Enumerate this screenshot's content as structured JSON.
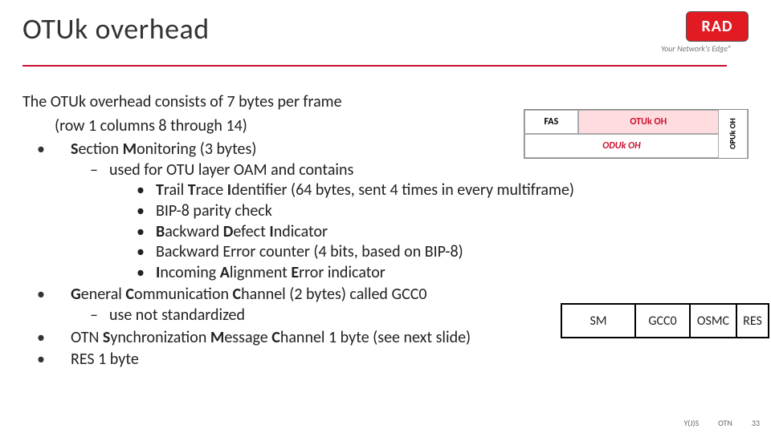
{
  "header": {
    "title": "OTUk overhead",
    "logo_text": "RAD",
    "tagline": "Your Network's Edge®"
  },
  "intro": {
    "line1": "The OTUk overhead consists of 7 bytes per frame",
    "line2": "(row 1 columns 8 through 14)"
  },
  "bullets": {
    "sm_label_pre": "S",
    "sm_label_mid1": "ection ",
    "sm_label_mid2": "M",
    "sm_label_post": "onitoring (3 bytes)",
    "sm_sub": "used for OTU layer OAM and contains",
    "sm_items": {
      "tti_pre": "T",
      "tti_mid1": "rail ",
      "tti_mid2": "T",
      "tti_mid3": "race ",
      "tti_mid4": "I",
      "tti_post": "dentifier (64 bytes, sent 4 times in every multiframe)",
      "bip8": "BIP-8 parity check",
      "bdi_pre": "B",
      "bdi_mid1": "ackward ",
      "bdi_mid2": "D",
      "bdi_mid3": "efect ",
      "bdi_mid4": "I",
      "bdi_post": "ndicator",
      "bec": "Backward Error counter (4 bits, based on BIP-8)",
      "iae_pre": "I",
      "iae_mid1": "ncoming ",
      "iae_mid2": "A",
      "iae_mid3": "lignment ",
      "iae_mid4": "E",
      "iae_post": "rror indicator"
    },
    "gcc_pre": "G",
    "gcc_mid1": "eneral ",
    "gcc_mid2": "C",
    "gcc_mid3": "ommunication ",
    "gcc_mid4": "C",
    "gcc_post": "hannel (2 bytes) called GCC0",
    "gcc_sub": "use not standardized",
    "smc_pre": "OTN ",
    "smc_mid1": "S",
    "smc_mid2": "ynchronization ",
    "smc_mid3": "M",
    "smc_mid4": "essage ",
    "smc_mid5": "C",
    "smc_post": "hannel 1 byte (see next slide)",
    "res": "RES 1 byte"
  },
  "mini_diagram": {
    "fas": "FAS",
    "otuk": "OTUk OH",
    "oduk": "ODUk OH",
    "opuk": "OPUk OH"
  },
  "byte_table": {
    "sm": "SM",
    "gcc0": "GCC0",
    "osmc": "OSMC",
    "res": "RES"
  },
  "footer": {
    "left": "Y(J)S",
    "mid": "OTN",
    "page": "33"
  }
}
